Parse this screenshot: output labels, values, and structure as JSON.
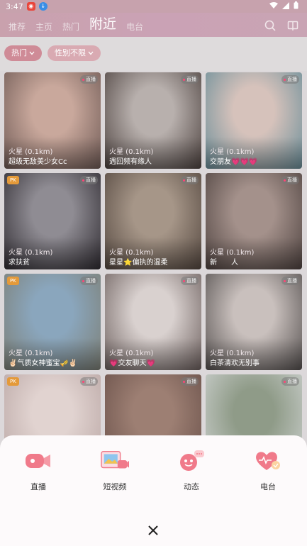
{
  "status_bar": {
    "time": "3:47"
  },
  "header": {
    "tabs": [
      {
        "label": "推荐"
      },
      {
        "label": "主页"
      },
      {
        "label": "热门"
      },
      {
        "label": "附近"
      },
      {
        "label": "电台"
      }
    ],
    "active_tab": "附近"
  },
  "filters": [
    {
      "label": "热门"
    },
    {
      "label": "性别不限"
    }
  ],
  "cards": [
    {
      "location": "火星 (0.1km)",
      "name": "超级无敌美少女Cc",
      "live": "直播",
      "pk": "",
      "colors": [
        "#c9a89c",
        "#6f5a55"
      ]
    },
    {
      "location": "火星 (0.1km)",
      "name": "遇回频有缘人",
      "live": "直播",
      "pk": "",
      "colors": [
        "#b8b0ad",
        "#4d423f"
      ]
    },
    {
      "location": "火星 (0.1km)",
      "name": "交朋友💗💗💗",
      "live": "直播",
      "pk": "",
      "colors": [
        "#d6c2bb",
        "#6a8e99"
      ]
    },
    {
      "location": "火星 (0.1km)",
      "name": "求扶贫",
      "live": "直播",
      "pk": "PK",
      "colors": [
        "#8f8c93",
        "#2f2b31"
      ]
    },
    {
      "location": "火星 (0.1km)",
      "name": "星星⭐偏执的温柔",
      "live": "直播",
      "pk": "",
      "colors": [
        "#a69688",
        "#54473f"
      ]
    },
    {
      "location": "火星 (0.1km)",
      "name": "新　　人",
      "live": "直播",
      "pk": "",
      "colors": [
        "#a4918b",
        "#4f4340"
      ]
    },
    {
      "location": "火星 (0.1km)",
      "name": "✌🏻气质女神蜜宝🎺✌🏻",
      "live": "直播",
      "pk": "PK",
      "colors": [
        "#8aa6bd",
        "#7d7f75"
      ]
    },
    {
      "location": "火星 (0.1km)",
      "name": "💗交友聊天💗",
      "live": "直播",
      "pk": "",
      "colors": [
        "#d9d1cf",
        "#6d605e"
      ]
    },
    {
      "location": "火星 (0.1km)",
      "name": "白茶清欢无别事",
      "live": "直播",
      "pk": "",
      "colors": [
        "#c9c0bd",
        "#55504f"
      ]
    },
    {
      "location": "",
      "name": "",
      "live": "直播",
      "pk": "PK",
      "colors": [
        "#e1d3d0",
        "#b9a6a4"
      ]
    },
    {
      "location": "",
      "name": "",
      "live": "直播",
      "pk": "",
      "colors": [
        "#9d7f73",
        "#6a514a"
      ]
    },
    {
      "location": "",
      "name": "",
      "live": "直播",
      "pk": "",
      "colors": [
        "#8f9b88",
        "#cdd1cf"
      ]
    }
  ],
  "sheet": {
    "items": [
      {
        "label": "直播",
        "icon": "live-camera-icon"
      },
      {
        "label": "短视频",
        "icon": "short-video-icon"
      },
      {
        "label": "动态",
        "icon": "moments-icon"
      },
      {
        "label": "电台",
        "icon": "radio-heart-icon"
      }
    ]
  },
  "colors": {
    "accent": "#cf8b97",
    "icon_pink": "#f07a8a"
  }
}
